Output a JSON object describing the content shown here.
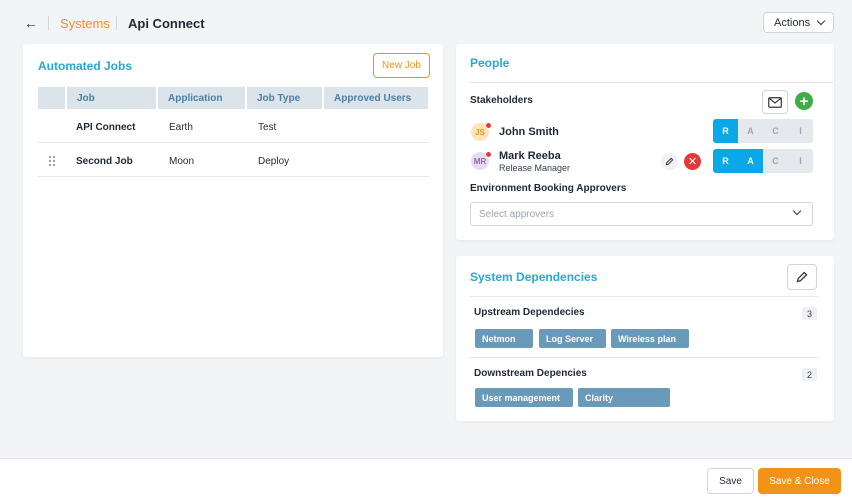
{
  "header": {
    "breadcrumb": "Systems",
    "title": "Api Connect",
    "actions_label": "Actions"
  },
  "jobs": {
    "title": "Automated Jobs",
    "new_job_label": "New Job",
    "columns": [
      "Job",
      "Application",
      "Job Type",
      "Approved Users"
    ],
    "rows": [
      {
        "job": "API Connect",
        "application": "Earth",
        "job_type": "Test",
        "approved_users": ""
      },
      {
        "job": "Second Job",
        "application": "Moon",
        "job_type": "Deploy",
        "approved_users": ""
      }
    ]
  },
  "people": {
    "title": "People",
    "stakeholders_label": "Stakeholders",
    "stakeholders": [
      {
        "initials": "JS",
        "name": "John Smith",
        "role": "",
        "avatar_bg": "#fde3b8",
        "avatar_fg": "#e59a2b",
        "raci": {
          "R": true,
          "A": false,
          "C": false,
          "I": false
        }
      },
      {
        "initials": "MR",
        "name": "Mark Reeba",
        "role": "Release Manager",
        "avatar_bg": "#e6dcef",
        "avatar_fg": "#8e6aa8",
        "raci": {
          "R": true,
          "A": true,
          "C": false,
          "I": false
        }
      }
    ],
    "raci_letters": [
      "R",
      "A",
      "C",
      "I"
    ],
    "approvers_label": "Environment Booking Approvers",
    "approvers_placeholder": "Select approvers"
  },
  "dependencies": {
    "title": "System Dependencies",
    "upstream_label": "Upstream Dependecies",
    "upstream_count": "3",
    "upstream": [
      "Netmon",
      "Log Server",
      "Wireless plan"
    ],
    "downstream_label": "Downstream Depencies",
    "downstream_count": "2",
    "downstream": [
      "User management",
      "Clarity"
    ]
  },
  "footer": {
    "save_label": "Save",
    "save_close_label": "Save & Close"
  },
  "colors": {
    "accent_orange": "#f39219",
    "title_blue": "#27a8d8",
    "raci_active": "#0aa8e6",
    "tag_blue": "#6a9ab9",
    "add_green": "#3fae49",
    "delete_red": "#e53935"
  }
}
